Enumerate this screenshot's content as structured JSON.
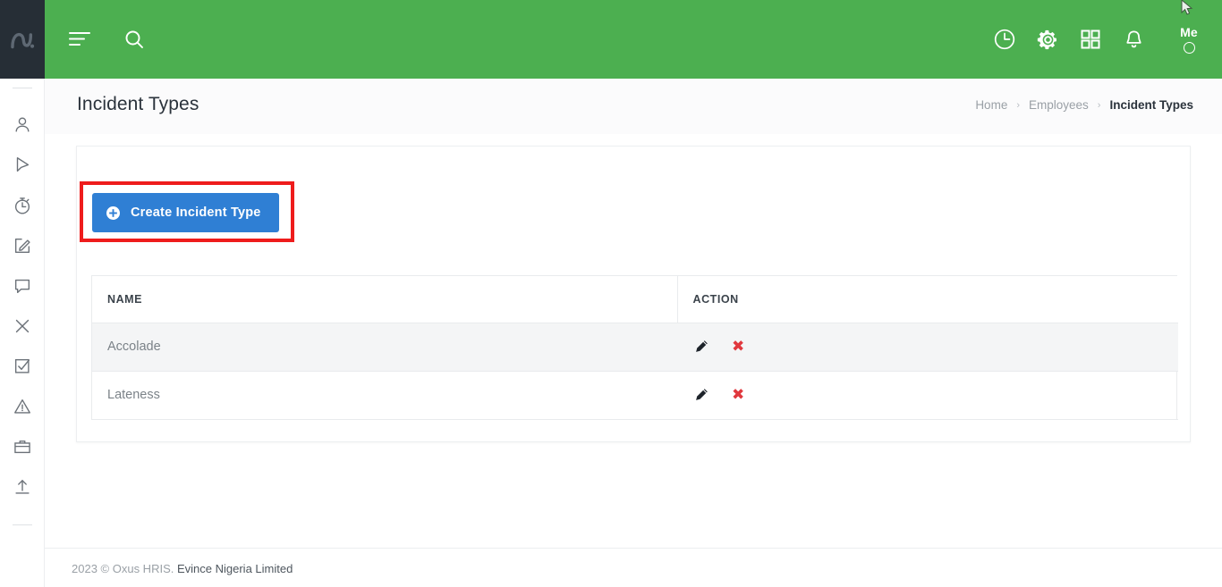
{
  "brand": {
    "logo_icon": "oxus-wave-logo",
    "header_color": "#4caf50",
    "logo_panel_color": "#262e36",
    "primary_button_color": "#2f7fd4",
    "highlight_color": "#ee1c1c",
    "delete_color": "#e0383e"
  },
  "topbar": {
    "menu_icon": "hamburger-menu-icon",
    "search_icon": "search-icon",
    "clock_icon": "clock-icon",
    "gear_icon": "gear-icon",
    "apps_icon": "apps-grid-icon",
    "bell_icon": "notification-bell-icon",
    "account_label": "Me",
    "avatar_icon": "avatar-circle-icon",
    "cursor_icon": "mouse-cursor-icon"
  },
  "sidebar": {
    "items": [
      {
        "icon": "user-icon",
        "name": "sidebar-item-user"
      },
      {
        "icon": "cursor-arrow-icon",
        "name": "sidebar-item-cursor"
      },
      {
        "icon": "stopwatch-icon",
        "name": "sidebar-item-stopwatch"
      },
      {
        "icon": "edit-note-icon",
        "name": "sidebar-item-edit-note"
      },
      {
        "icon": "chat-bubble-icon",
        "name": "sidebar-item-chat"
      },
      {
        "icon": "close-x-icon",
        "name": "sidebar-item-close"
      },
      {
        "icon": "checkbox-checked-icon",
        "name": "sidebar-item-checklist"
      },
      {
        "icon": "warning-triangle-icon",
        "name": "sidebar-item-warning"
      },
      {
        "icon": "briefcase-icon",
        "name": "sidebar-item-briefcase"
      },
      {
        "icon": "upload-arrow-icon",
        "name": "sidebar-item-upload"
      }
    ]
  },
  "page": {
    "title": "Incident Types",
    "breadcrumb": {
      "home": "Home",
      "section": "Employees",
      "current": "Incident Types",
      "separator": "›"
    }
  },
  "card": {
    "create_button": {
      "label": "Create Incident Type",
      "icon": "plus-circle-icon"
    },
    "table": {
      "columns": [
        "NAME",
        "ACTION"
      ],
      "rows": [
        {
          "name": "Accolade",
          "edit_icon": "pencil-edit-icon",
          "delete_icon": "delete-x-icon"
        },
        {
          "name": "Lateness",
          "edit_icon": "pencil-edit-icon",
          "delete_icon": "delete-x-icon"
        }
      ],
      "delete_glyph": "✖"
    }
  },
  "footer": {
    "copyright": "2023 © Oxus HRIS.",
    "company": "Evince Nigeria Limited"
  }
}
